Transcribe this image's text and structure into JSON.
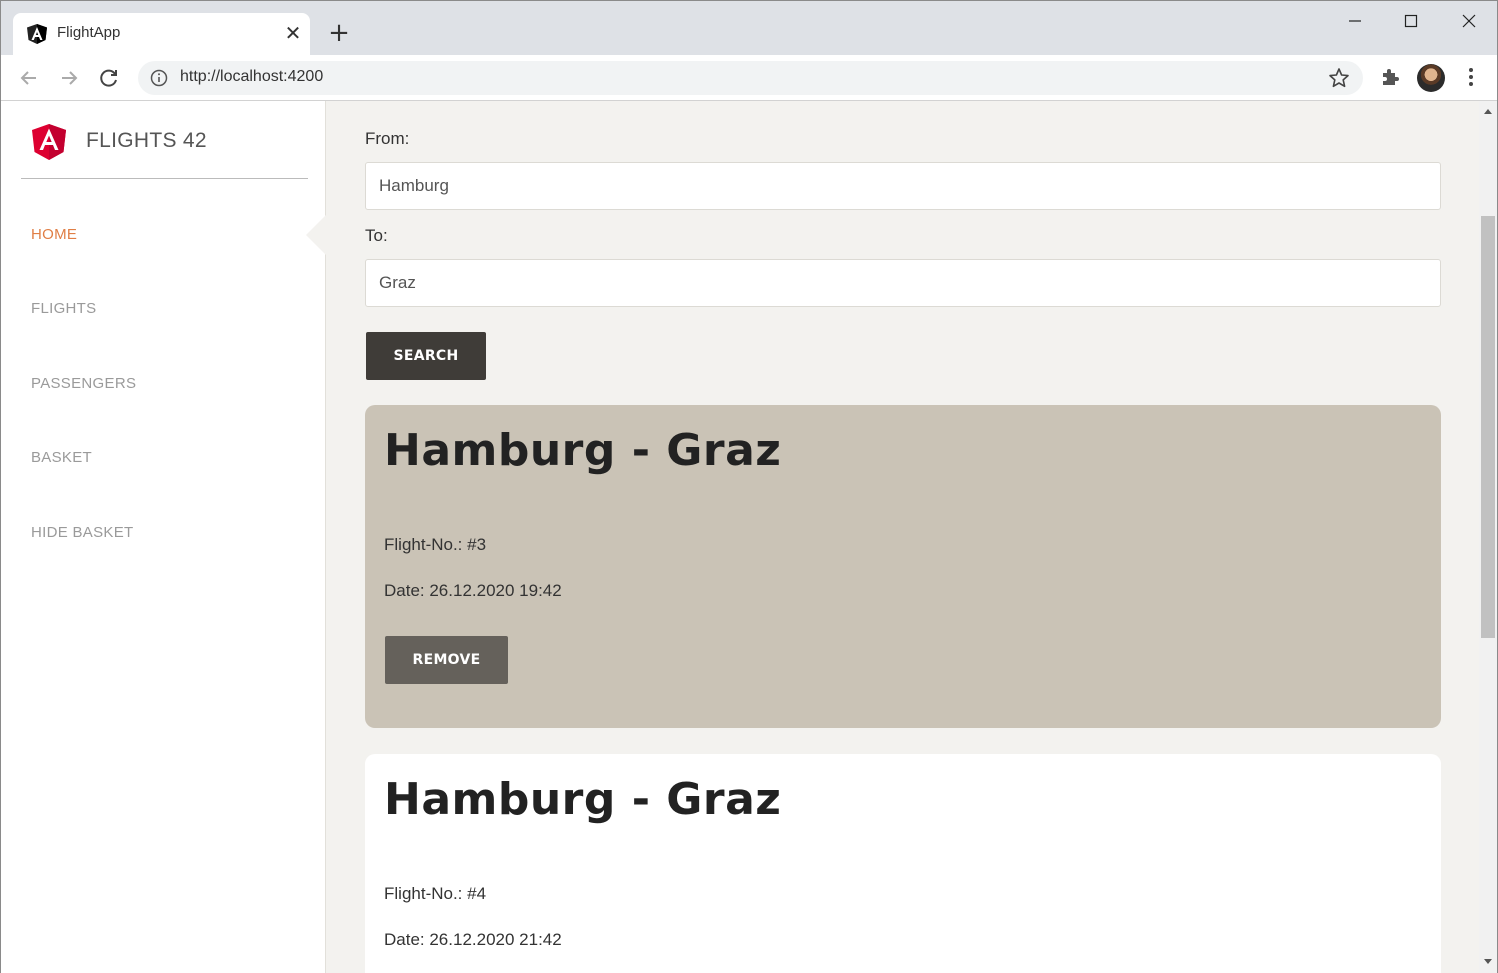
{
  "browser": {
    "tab_title": "FlightApp",
    "url": "http://localhost:4200"
  },
  "sidebar": {
    "brand": "FLIGHTS 42",
    "items": [
      {
        "label": "HOME",
        "active": true
      },
      {
        "label": "FLIGHTS",
        "active": false
      },
      {
        "label": "PASSENGERS",
        "active": false
      },
      {
        "label": "BASKET",
        "active": false
      },
      {
        "label": "HIDE BASKET",
        "active": false
      }
    ]
  },
  "search": {
    "from_label": "From:",
    "from_value": "Hamburg",
    "to_label": "To:",
    "to_value": "Graz",
    "button_label": "SEARCH"
  },
  "flights": [
    {
      "title": "Hamburg - Graz",
      "flight_no": "Flight-No.: #3",
      "date": "Date: 26.12.2020 19:42",
      "selected": true,
      "button_label": "REMOVE"
    },
    {
      "title": "Hamburg - Graz",
      "flight_no": "Flight-No.: #4",
      "date": "Date: 26.12.2020 21:42",
      "selected": false
    }
  ],
  "colors": {
    "accent": "#e07e45",
    "selected_card": "#cac3b6",
    "button": "#3f3c38",
    "page_bg": "#f3f2ef"
  }
}
